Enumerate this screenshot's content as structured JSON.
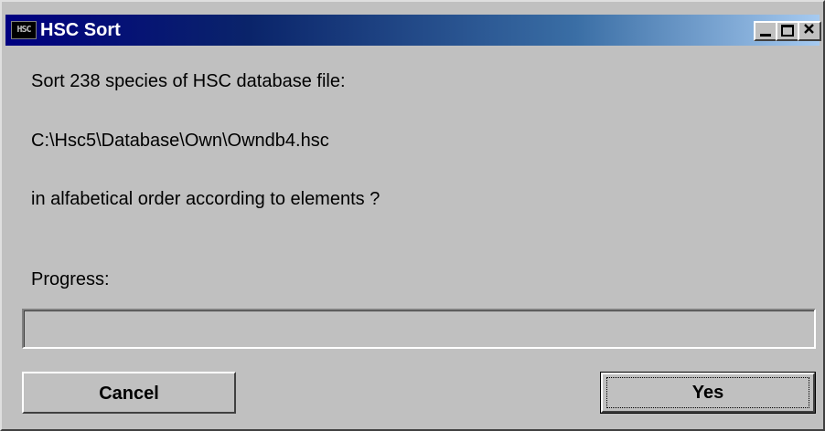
{
  "window": {
    "title": "HSC Sort",
    "icon": "hsc-app-icon",
    "icon_text": "HSC"
  },
  "titlebar_buttons": {
    "minimize": "minimize-icon",
    "maximize": "maximize-icon",
    "close": "close-icon"
  },
  "message": {
    "line1": "Sort  238 species of HSC database file:",
    "line2": "C:\\Hsc5\\Database\\Own\\Owndb4.hsc",
    "line3": "in alfabetical order according to elements ?"
  },
  "progress": {
    "label": "Progress:",
    "value": 0
  },
  "buttons": {
    "cancel": "Cancel",
    "yes": "Yes"
  },
  "colors": {
    "titlebar_start": "#000080",
    "titlebar_end": "#a6caf0",
    "face": "#c0c0c0"
  }
}
